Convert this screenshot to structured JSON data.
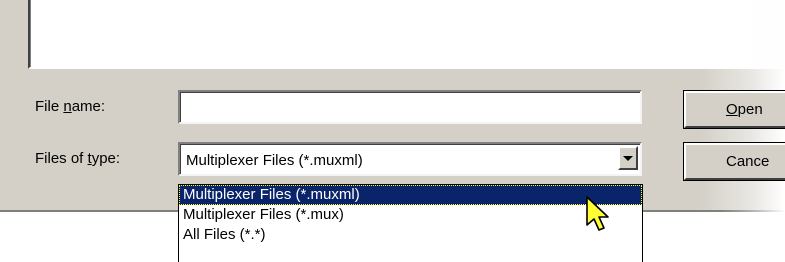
{
  "file_name": {
    "label_prefix": "File ",
    "label_mnemonic": "n",
    "label_suffix": "ame:",
    "value": ""
  },
  "file_type": {
    "label_prefix": "Files of ",
    "label_mnemonic": "t",
    "label_suffix": "ype:",
    "selected": "Multiplexer Files (*.muxml)",
    "options": [
      "Multiplexer Files (*.muxml)",
      "Multiplexer Files (*.mux)",
      "All Files (*.*)"
    ]
  },
  "buttons": {
    "open_mnemonic": "O",
    "open_rest": "pen",
    "cancel": "Cance"
  },
  "icons": {
    "dropdown_arrow": "chevron-down-icon",
    "cursor": "mouse-pointer-icon"
  },
  "colors": {
    "dialog_face": "#d4d0c8",
    "selection_bg": "#0a246a",
    "selection_text": "#ffffff",
    "cursor_fill": "#ffff33"
  }
}
